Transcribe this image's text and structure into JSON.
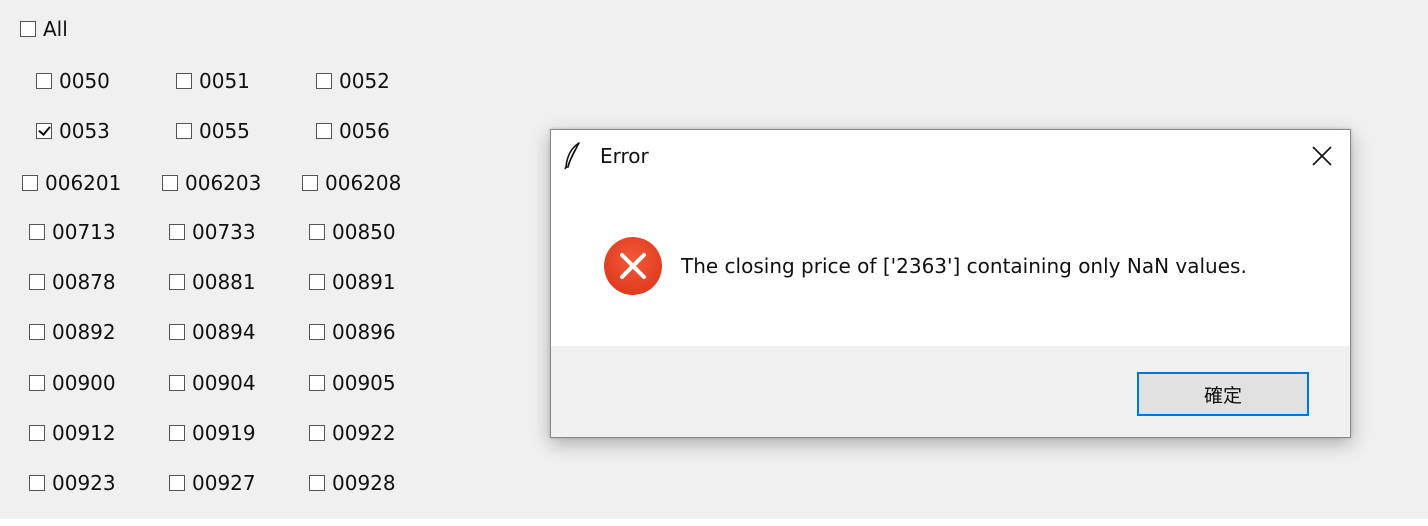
{
  "checkbox_all": {
    "label": "All",
    "checked": false
  },
  "codes": [
    {
      "label": "0050",
      "checked": false
    },
    {
      "label": "0051",
      "checked": false
    },
    {
      "label": "0052",
      "checked": false
    },
    {
      "label": "0053",
      "checked": true
    },
    {
      "label": "0055",
      "checked": false
    },
    {
      "label": "0056",
      "checked": false
    },
    {
      "label": "006201",
      "checked": false
    },
    {
      "label": "006203",
      "checked": false
    },
    {
      "label": "006208",
      "checked": false
    },
    {
      "label": "00713",
      "checked": false
    },
    {
      "label": "00733",
      "checked": false
    },
    {
      "label": "00850",
      "checked": false
    },
    {
      "label": "00878",
      "checked": false
    },
    {
      "label": "00881",
      "checked": false
    },
    {
      "label": "00891",
      "checked": false
    },
    {
      "label": "00892",
      "checked": false
    },
    {
      "label": "00894",
      "checked": false
    },
    {
      "label": "00896",
      "checked": false
    },
    {
      "label": "00900",
      "checked": false
    },
    {
      "label": "00904",
      "checked": false
    },
    {
      "label": "00905",
      "checked": false
    },
    {
      "label": "00912",
      "checked": false
    },
    {
      "label": "00919",
      "checked": false
    },
    {
      "label": "00922",
      "checked": false
    },
    {
      "label": "00923",
      "checked": false
    },
    {
      "label": "00927",
      "checked": false
    },
    {
      "label": "00928",
      "checked": false
    }
  ],
  "dialog": {
    "title": "Error",
    "title_icon": "feather-icon",
    "close_icon": "close-icon",
    "status_icon": "error-icon",
    "message": "The closing price of ['2363'] containing only NaN values.",
    "ok_label": "確定"
  },
  "colors": {
    "window_background": "#f0f0f0",
    "dialog_background": "#ffffff",
    "error_red": "#e81123",
    "focus_border": "#0078d7"
  }
}
